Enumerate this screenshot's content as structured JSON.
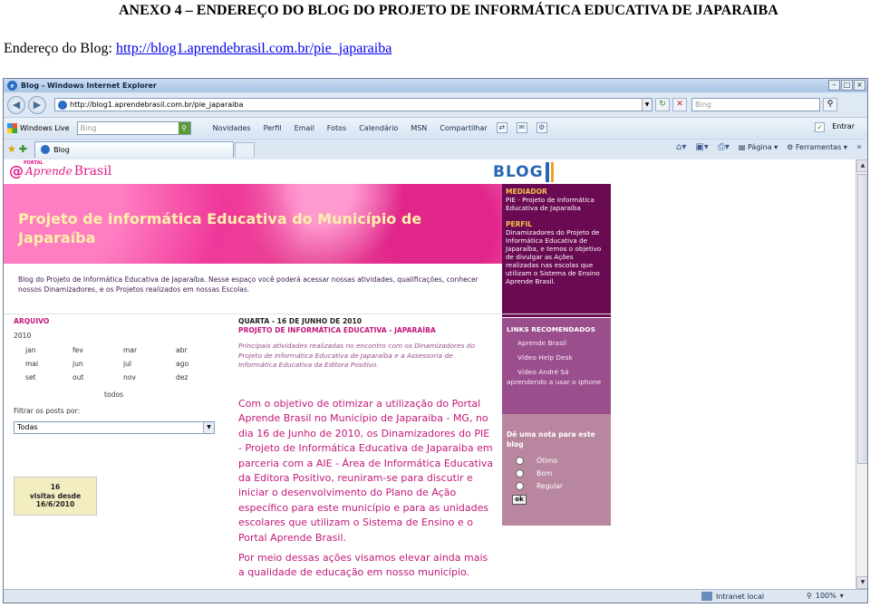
{
  "doc": {
    "heading": "ANEXO 4 – ENDEREÇO DO BLOG DO PROJETO DE INFORMÁTICA EDUCATIVA DE JAPARAIBA",
    "address_label": "Endereço do Blog:",
    "address_url": "http://blog1.aprendebrasil.com.br/pie_japaraiba"
  },
  "browser": {
    "window_title": "Blog - Windows Internet Explorer",
    "address": "http://blog1.aprendebrasil.com.br/pie_japaraiba",
    "search_placeholder": "Bing",
    "live_label": "Windows Live",
    "live_search_placeholder": "Bing",
    "live_links": [
      "Novidades",
      "Perfil",
      "Email",
      "Fotos",
      "Calendário",
      "MSN",
      "Compartilhar"
    ],
    "entrar": "Entrar",
    "tab_title": "Blog",
    "cmd_page": "Página",
    "cmd_tools": "Ferramentas",
    "status_zone": "Intranet local",
    "zoom": "100%",
    "colors": {
      "accent": "#2766b5",
      "frame": "#dfe9f5"
    }
  },
  "page": {
    "logo": {
      "portal": "PORTAL",
      "at": "@",
      "aprende": "Aprende",
      "brasil": "Brasil"
    },
    "blog_mark": "BLOG",
    "site_title": "Projeto de informática Educativa do Município de Japaraíba",
    "intro": "Blog do Projeto de Informática Educativa de Japaraíba. Nesse espaço você poderá acessar nossas atividades, qualificações, conhecer nossos Dinamizadores, e os Projetos realizados em nossas Escolas.",
    "sidebar": {
      "mediador_title": "MEDIADOR",
      "mediador_text": "PIE - Projeto de Informática Educativa de Japaraíba",
      "perfil_title": "PERFIL",
      "perfil_text": "Dinamizadores do Projeto de Informática Educativa de Japaraíba, e temos o objetivo de divulgar as Ações realizadas nas escolas que utilizam o Sistema de Ensino Aprende Brasil."
    },
    "archive": {
      "title": "ARQUIVO",
      "year": "2010",
      "months": [
        "jan",
        "fev",
        "mar",
        "abr",
        "mai",
        "jun",
        "jul",
        "ago",
        "set",
        "out",
        "nov",
        "dez"
      ],
      "all": "todos",
      "filter_label": "Filtrar os posts por:",
      "filter_value": "Todas"
    },
    "counter": {
      "count": "16",
      "label": "visitas desde",
      "since": "16/6/2010"
    },
    "post": {
      "date": "QUARTA - 16 DE JUNHO DE 2010",
      "title": "PROJETO DE INFORMÁTICA EDUCATIVA - JAPARAÍBA",
      "summary": "Principais atividades realizadas no encontro com os Dinamizadores do Projeto de Informática Educativa de Japaraíba e a Assessoria de Informática Educativa da Editora Positivo.",
      "body": "Com o objetivo de otimizar a utilização do Portal Aprende Brasil no Município de Japaraiba - MG, no dia 16 de Junho de 2010, os  Dinamizadores do PIE - Projeto de Informática Educativa de Japaraiba em parceria com a AIE - Área de Informática Educativa da Editora Positivo, reuniram-se para discutir e iniciar o desenvolvimento do Plano de Ação específico para este município e para as unidades escolares que utilizam o Sistema de Ensino e o Portal Aprende Brasil.",
      "body2": "Por meio dessas ações visamos elevar ainda mais a qualidade de educação em nosso município."
    },
    "links": {
      "title": "LINKS RECOMENDADOS",
      "items": [
        "Aprende Brasil",
        "Vídeo Help Desk",
        "Vídeo André Sá aprendendo a usar o Iphone"
      ]
    },
    "rating": {
      "title": "Dê uma nota para este blog",
      "options": [
        "Ótimo",
        "Bom",
        "Regular"
      ],
      "ok": "ok"
    }
  }
}
